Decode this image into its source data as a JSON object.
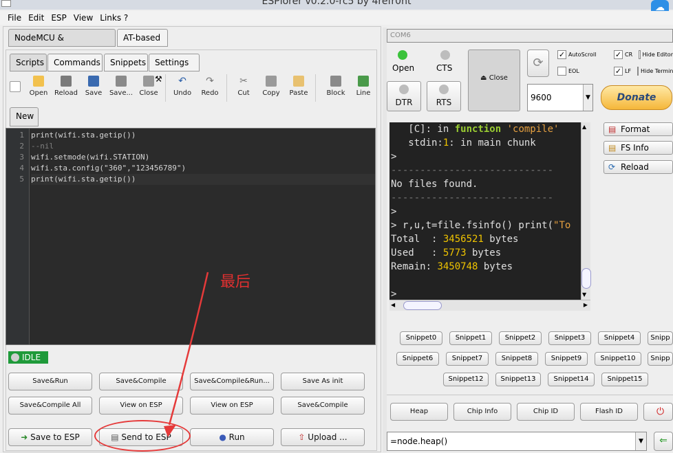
{
  "window": {
    "title": "ESPlorer v0.2.0-rc5 by 4refr0nt"
  },
  "menu": [
    "File",
    "Edit",
    "ESP",
    "View",
    "Links ?"
  ],
  "top_tabs": [
    "NodeMCU & MicroPython",
    "AT-based"
  ],
  "sub_tabs": [
    "Scripts",
    "Commands",
    "Snippets",
    "Settings"
  ],
  "toolbar": [
    "Open",
    "Reload",
    "Save",
    "Save...",
    "Close",
    "Undo",
    "Redo",
    "Cut",
    "Copy",
    "Paste",
    "Block",
    "Line"
  ],
  "file_tab": "New",
  "editor": {
    "line_numbers": [
      "1",
      "2",
      "3",
      "4",
      "5"
    ],
    "lines": [
      "print(wifi.sta.getip())",
      "--nil",
      "wifi.setmode(wifi.STATION)",
      "wifi.sta.config(\"360\",\"123456789\")",
      "print(wifi.sta.getip())"
    ]
  },
  "status": "IDLE",
  "buttons_row1": [
    "Save&Run",
    "Save&Compile",
    "Save&Compile&Run...",
    "Save As init"
  ],
  "buttons_row2": [
    "Save&Compile All",
    "View on ESP",
    "View on ESP",
    "Save&Compile"
  ],
  "buttons_row3": [
    "Save to ESP",
    "Send to ESP",
    "Run",
    "Upload ..."
  ],
  "annotation": "最后",
  "port": "COM6",
  "port_controls": {
    "open": "Open",
    "cts": "CTS",
    "dtr": "DTR",
    "rts": "RTS",
    "close": "Close"
  },
  "checkboxes": [
    {
      "label": "AutoScroll",
      "checked": true
    },
    {
      "label": "EOL",
      "checked": false
    },
    {
      "label": "CR",
      "checked": true
    },
    {
      "label": "LF",
      "checked": true
    },
    {
      "label": "Hide Editor",
      "checked": false
    },
    {
      "label": "Hide Terminal",
      "checked": false
    }
  ],
  "baud": "9600",
  "donate": "Donate",
  "terminal": {
    "line0_prefix": "   [C]: in ",
    "line0_kw": "function",
    "line0_str": " 'compile'",
    "line1_prefix": "   stdin:",
    "line1_num": "1",
    "line1_rest": ": in main chunk",
    "prompt": ">",
    "dashes": "----------------------------",
    "no_files": "No files found.",
    "cmd_prefix": "> r,u,t=file.fsinfo() print(",
    "cmd_str": "\"To",
    "total_label": "Total  : ",
    "total_val": "3456521",
    "unit": " bytes",
    "used_label": "Used   : ",
    "used_val": "5773",
    "remain_label": "Remain: ",
    "remain_val": "3450748"
  },
  "right_buttons": [
    "Format",
    "FS Info",
    "Reload"
  ],
  "snippets_row1": [
    "Snippet0",
    "Snippet1",
    "Snippet2",
    "Snippet3",
    "Snippet4",
    "Snipp"
  ],
  "snippets_row2": [
    "Snippet6",
    "Snippet7",
    "Snippet8",
    "Snippet9",
    "Snippet10",
    "Snipp"
  ],
  "snippets_row3": [
    "Snippet12",
    "Snippet13",
    "Snippet14",
    "Snippet15"
  ],
  "bottom_buttons": [
    "Heap",
    "Chip Info",
    "Chip ID",
    "Flash ID"
  ],
  "command_input": "=node.heap()"
}
